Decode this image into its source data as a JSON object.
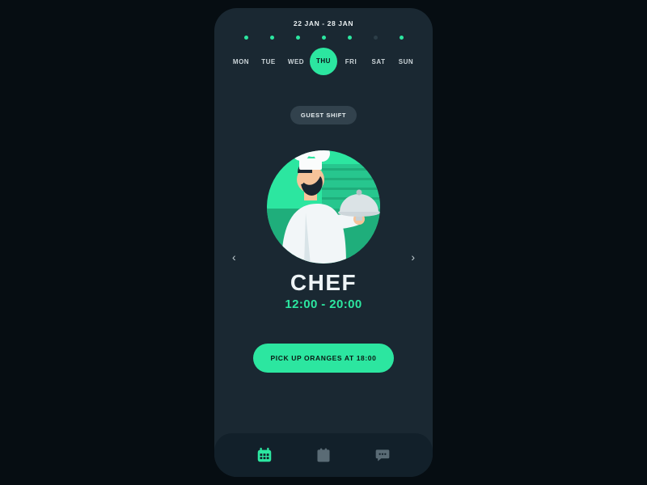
{
  "header": {
    "date_range": "22 JAN - 28 JAN"
  },
  "dots": [
    {
      "active": true
    },
    {
      "active": true
    },
    {
      "active": true
    },
    {
      "active": true
    },
    {
      "active": true
    },
    {
      "active": false
    },
    {
      "active": true
    }
  ],
  "days": [
    {
      "label": "MON",
      "selected": false
    },
    {
      "label": "TUE",
      "selected": false
    },
    {
      "label": "WED",
      "selected": false
    },
    {
      "label": "THU",
      "selected": true
    },
    {
      "label": "FRI",
      "selected": false
    },
    {
      "label": "SAT",
      "selected": false
    },
    {
      "label": "SUN",
      "selected": false
    }
  ],
  "shift": {
    "badge": "GUEST SHIFT",
    "role": "CHEF",
    "time": "12:00 - 20:00"
  },
  "cta": {
    "label": "PICK UP ORANGES AT 18:00"
  },
  "nav": {
    "items": [
      {
        "name": "calendar",
        "active": true
      },
      {
        "name": "list",
        "active": false
      },
      {
        "name": "chat",
        "active": false
      }
    ]
  }
}
